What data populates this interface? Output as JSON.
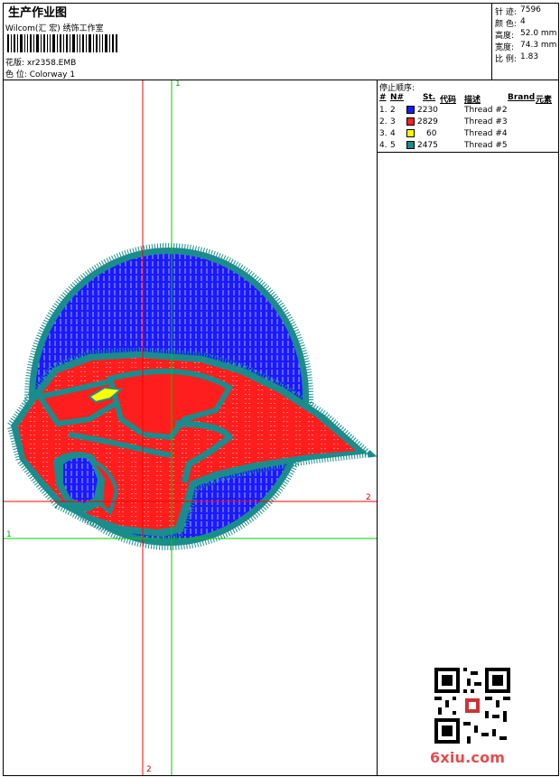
{
  "header": {
    "title": "生产作业图",
    "company": "Wilcom(汇 宏) 绣饰工作室",
    "design_label": "花版: xr2358.EMB",
    "color_label": "色 位:  Colorway 1"
  },
  "stats": [
    {
      "label": "针 迹:",
      "value": "7596"
    },
    {
      "label": "颜 色:",
      "value": "4"
    },
    {
      "label": "高度:",
      "value": "52.0 mm"
    },
    {
      "label": "宽度:",
      "value": "74.3 mm"
    },
    {
      "label": "比 例:",
      "value": "1.83"
    }
  ],
  "legend": {
    "title": "停止顺序:",
    "headers": [
      "#",
      "N#",
      "St.",
      "代码",
      "描述",
      "Brand",
      "元素"
    ],
    "rows": [
      {
        "idx": "1.",
        "n": "2",
        "st": "2230",
        "desc": "Thread #2",
        "color": "#1a1aff"
      },
      {
        "idx": "2.",
        "n": "3",
        "st": "2829",
        "desc": "Thread #3",
        "color": "#ff2020"
      },
      {
        "idx": "3.",
        "n": "4",
        "st": "60",
        "desc": "Thread #4",
        "color": "#ffff00"
      },
      {
        "idx": "4.",
        "n": "5",
        "st": "2475",
        "desc": "Thread #5",
        "color": "#1a8c8c"
      }
    ]
  },
  "guides": {
    "vertical_green_label": "1",
    "horizontal_red_label": "2",
    "horizontal_green_label": "1",
    "vertical_red_label": "2"
  },
  "footer": {
    "site": "6xiu.com"
  }
}
